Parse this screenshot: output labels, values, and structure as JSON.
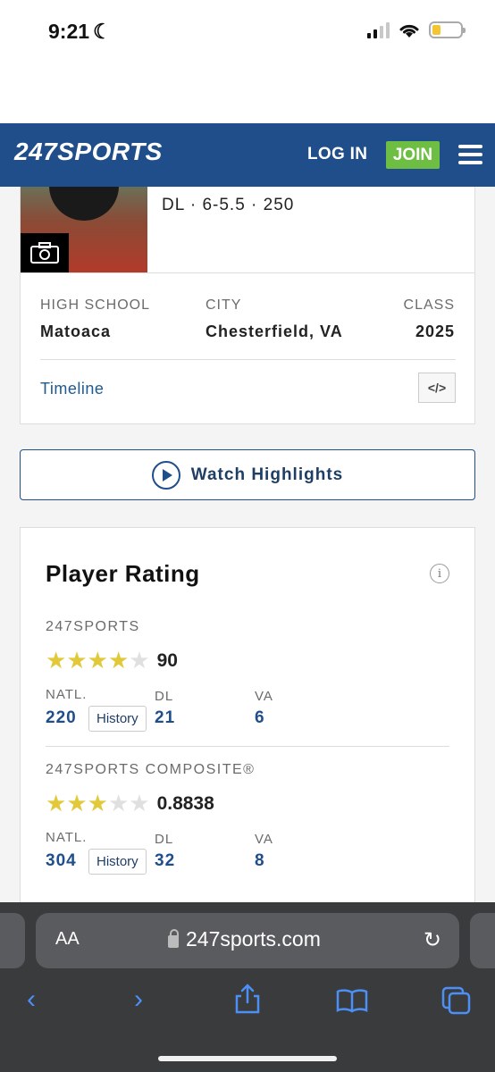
{
  "status_bar": {
    "time": "9:21"
  },
  "header": {
    "logo": "247SPORTS",
    "login": "LOG IN",
    "join": "JOIN"
  },
  "profile": {
    "bio": "DL · 6-5.5 · 250",
    "high_school_label": "HIGH SCHOOL",
    "high_school": "Matoaca",
    "city_label": "CITY",
    "city": "Chesterfield, VA",
    "class_label": "CLASS",
    "class": "2025",
    "timeline": "Timeline",
    "embed": "</>"
  },
  "highlights": {
    "label": "Watch Highlights"
  },
  "rating": {
    "title": "Player Rating",
    "info": "i",
    "sources": [
      {
        "name": "247SPORTS",
        "stars": 4,
        "score": "90",
        "natl_label": "NATL.",
        "natl": "220",
        "history": "History",
        "pos_label": "DL",
        "pos": "21",
        "state_label": "VA",
        "state": "6"
      },
      {
        "name": "247SPORTS COMPOSITE®",
        "stars": 3,
        "score": "0.8838",
        "natl_label": "NATL.",
        "natl": "304",
        "history": "History",
        "pos_label": "DL",
        "pos": "32",
        "state_label": "VA",
        "state": "8"
      }
    ]
  },
  "browser": {
    "aa": "AA",
    "url": "247sports.com"
  },
  "colors": {
    "brand": "#1f4e8a",
    "join": "#6fbe44",
    "star": "#e1c93a"
  }
}
